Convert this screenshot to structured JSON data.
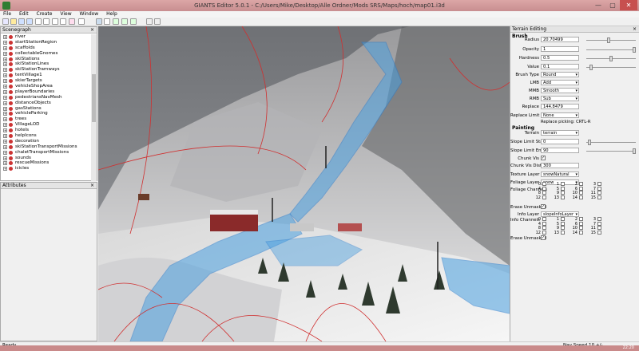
{
  "window": {
    "title": "GIANTS Editor 5.0.1 - C:/Users/Mike/Desktop/Alle Ordner/Mods SRS/Maps/hoch/map01.i3d",
    "minimize": "—",
    "maximize": "▢",
    "close": "✕"
  },
  "menu": [
    "File",
    "Edit",
    "Create",
    "View",
    "Window",
    "Help"
  ],
  "scenegraph": {
    "title": "Scenegraph",
    "close": "×",
    "items": [
      "river",
      "startStationRegion",
      "scaffolds",
      "collectableGnomes",
      "skiStations",
      "skiStationLines",
      "skiStationTramways",
      "tentVillage1",
      "skierTargets",
      "vehicleShopArea",
      "playerBoundaries",
      "pedestriansNavMesh",
      "distanceObjects",
      "gasStations",
      "vehicleParking",
      "trees",
      "VillageLOD",
      "hotels",
      "helpIcons",
      "decoration",
      "skiStationTransportMissions",
      "chaletTransportMissions",
      "sounds",
      "rescueMissions",
      "icicles"
    ]
  },
  "attributes": {
    "title": "Attributes",
    "close": "×"
  },
  "terrain": {
    "title": "Terrain Editing",
    "close": "×",
    "brush_header": "Brush",
    "radius_label": "Radius",
    "radius": "20.70499",
    "opacity_label": "Opacity",
    "opacity": "1",
    "hardness_label": "Hardness",
    "hardness": "0.5",
    "value_label": "Value",
    "value": "0.1",
    "brush_type_label": "Brush Type",
    "brush_type": "Round",
    "lmb_label": "LMB",
    "lmb": "Add",
    "mmb_label": "MMB",
    "mmb": "Smooth",
    "rmb_label": "RMB",
    "rmb": "Sub",
    "replace_label": "Replace",
    "replace": "144.8479",
    "replace_limit_label": "Replace Limit",
    "replace_limit": "None",
    "replace_picking": "Replace picking: CRTL-R",
    "painting_header": "Painting",
    "terrain_label": "Terrain",
    "terrain_value": "terrain",
    "slope_start_label": "Slope Limit Start",
    "slope_start": "0",
    "slope_end_label": "Slope Limit End",
    "slope_end": "90",
    "chunk_vis_label": "Chunk Vis",
    "chunk_vis_dist_label": "Chunk Vis Dist",
    "chunk_vis_dist": "300",
    "texture_layer_label": "Texture Layer",
    "texture_layer": "snowNatural",
    "foliage_layer_label": "Foliage Layer",
    "foliage_layer": "snow",
    "foliage_channels_label": "Foliage Channels",
    "erase_unmasked_label": "Erase Unmasked",
    "info_layer_label": "Info Layer",
    "info_layer": "slopeInfoLayer",
    "info_channels_label": "Info Channels",
    "erase_unmasked2_label": "Erase Unmasked",
    "channel_numbers": [
      "0",
      "1",
      "2",
      "3",
      "4",
      "5",
      "6",
      "7",
      "8",
      "9",
      "10",
      "11",
      "12",
      "13",
      "14",
      "15"
    ]
  },
  "status": {
    "ready": "Ready",
    "speed": "Nav Speed 10 +/-",
    "clock": "22:20"
  },
  "colors": {
    "titlebar": "#c88e90",
    "river": "#4aa0e0",
    "spline": "#d03030"
  }
}
